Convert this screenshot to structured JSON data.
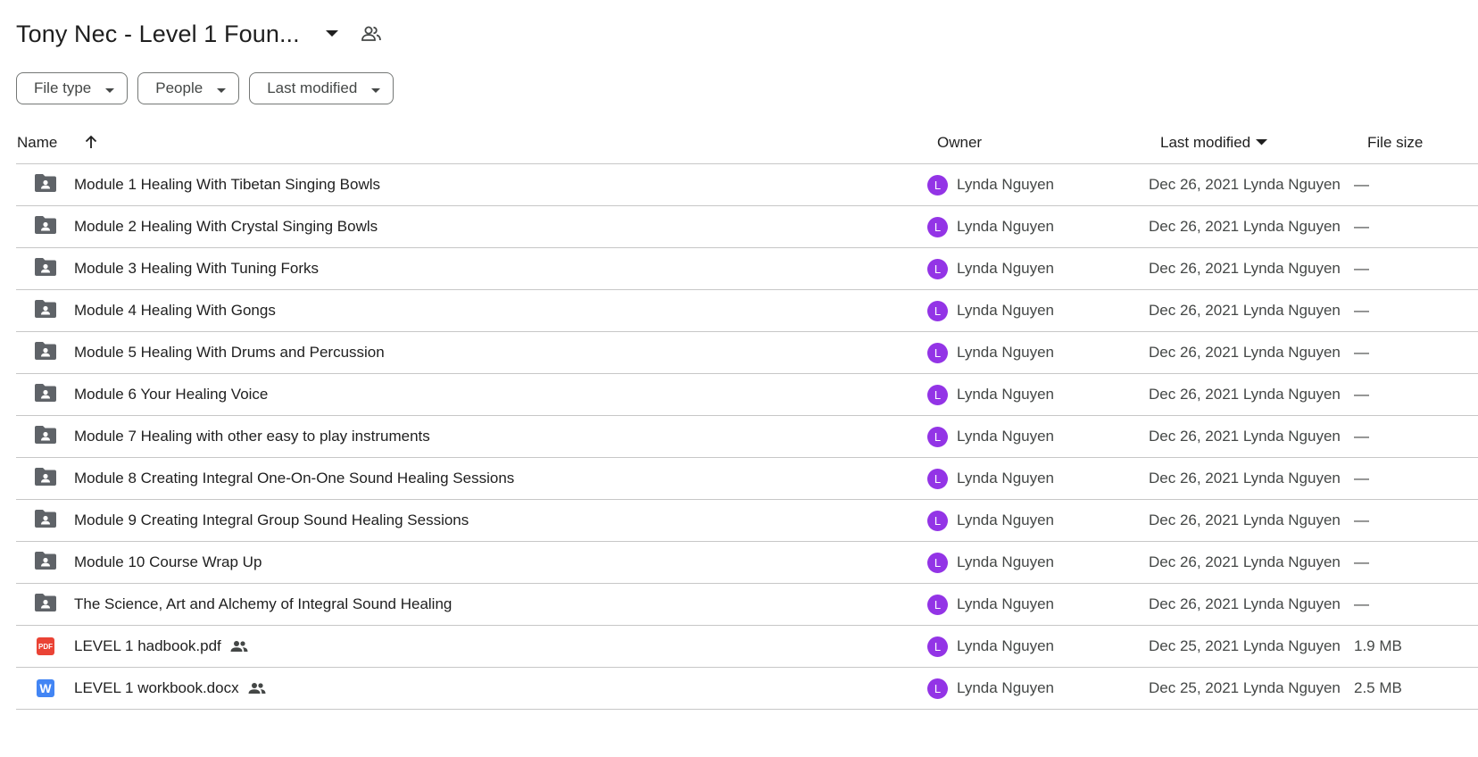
{
  "header": {
    "title": "Tony Nec - Level 1 Foun...",
    "dropdown_icon": "arrow-drop-down-icon",
    "share_icon": "people-outline-icon"
  },
  "filters": [
    {
      "label": "File type"
    },
    {
      "label": "People"
    },
    {
      "label": "Last modified"
    }
  ],
  "columns": {
    "name": "Name",
    "owner": "Owner",
    "last_modified": "Last modified",
    "file_size": "File size"
  },
  "colors": {
    "avatar": "#9334e6",
    "folder_icon": "#5f6368",
    "pdf": "#ea4335",
    "docx": "#4285f4"
  },
  "rows": [
    {
      "type": "shared-folder",
      "name": "Module 1 Healing With Tibetan Singing Bowls",
      "shared": false,
      "owner_initial": "L",
      "owner": "Lynda Nguyen",
      "modified": "Dec 26, 2021 Lynda Nguyen",
      "size": "—"
    },
    {
      "type": "shared-folder",
      "name": "Module 2 Healing With Crystal Singing Bowls",
      "shared": false,
      "owner_initial": "L",
      "owner": "Lynda Nguyen",
      "modified": "Dec 26, 2021 Lynda Nguyen",
      "size": "—"
    },
    {
      "type": "shared-folder",
      "name": "Module 3 Healing With Tuning Forks",
      "shared": false,
      "owner_initial": "L",
      "owner": "Lynda Nguyen",
      "modified": "Dec 26, 2021 Lynda Nguyen",
      "size": "—"
    },
    {
      "type": "shared-folder",
      "name": "Module 4 Healing With Gongs",
      "shared": false,
      "owner_initial": "L",
      "owner": "Lynda Nguyen",
      "modified": "Dec 26, 2021 Lynda Nguyen",
      "size": "—"
    },
    {
      "type": "shared-folder",
      "name": "Module 5 Healing With Drums and Percussion",
      "shared": false,
      "owner_initial": "L",
      "owner": "Lynda Nguyen",
      "modified": "Dec 26, 2021 Lynda Nguyen",
      "size": "—"
    },
    {
      "type": "shared-folder",
      "name": "Module 6 Your Healing Voice",
      "shared": false,
      "owner_initial": "L",
      "owner": "Lynda Nguyen",
      "modified": "Dec 26, 2021 Lynda Nguyen",
      "size": "—"
    },
    {
      "type": "shared-folder",
      "name": "Module 7 Healing with other easy to play instruments",
      "shared": false,
      "owner_initial": "L",
      "owner": "Lynda Nguyen",
      "modified": "Dec 26, 2021 Lynda Nguyen",
      "size": "—"
    },
    {
      "type": "shared-folder",
      "name": "Module 8 Creating Integral One-On-One Sound Healing Sessions",
      "shared": false,
      "owner_initial": "L",
      "owner": "Lynda Nguyen",
      "modified": "Dec 26, 2021 Lynda Nguyen",
      "size": "—"
    },
    {
      "type": "shared-folder",
      "name": "Module 9 Creating Integral Group Sound Healing Sessions",
      "shared": false,
      "owner_initial": "L",
      "owner": "Lynda Nguyen",
      "modified": "Dec 26, 2021 Lynda Nguyen",
      "size": "—"
    },
    {
      "type": "shared-folder",
      "name": "Module 10 Course Wrap Up",
      "shared": false,
      "owner_initial": "L",
      "owner": "Lynda Nguyen",
      "modified": "Dec 26, 2021 Lynda Nguyen",
      "size": "—"
    },
    {
      "type": "shared-folder",
      "name": "The Science, Art and Alchemy of Integral Sound Healing",
      "shared": false,
      "owner_initial": "L",
      "owner": "Lynda Nguyen",
      "modified": "Dec 26, 2021 Lynda Nguyen",
      "size": "—"
    },
    {
      "type": "pdf",
      "icon_text": "PDF",
      "name": "LEVEL 1 hadbook.pdf",
      "shared": true,
      "owner_initial": "L",
      "owner": "Lynda Nguyen",
      "modified": "Dec 25, 2021 Lynda Nguyen",
      "size": "1.9 MB"
    },
    {
      "type": "docx",
      "icon_text": "W",
      "name": "LEVEL 1 workbook.docx",
      "shared": true,
      "owner_initial": "L",
      "owner": "Lynda Nguyen",
      "modified": "Dec 25, 2021 Lynda Nguyen",
      "size": "2.5 MB"
    }
  ]
}
